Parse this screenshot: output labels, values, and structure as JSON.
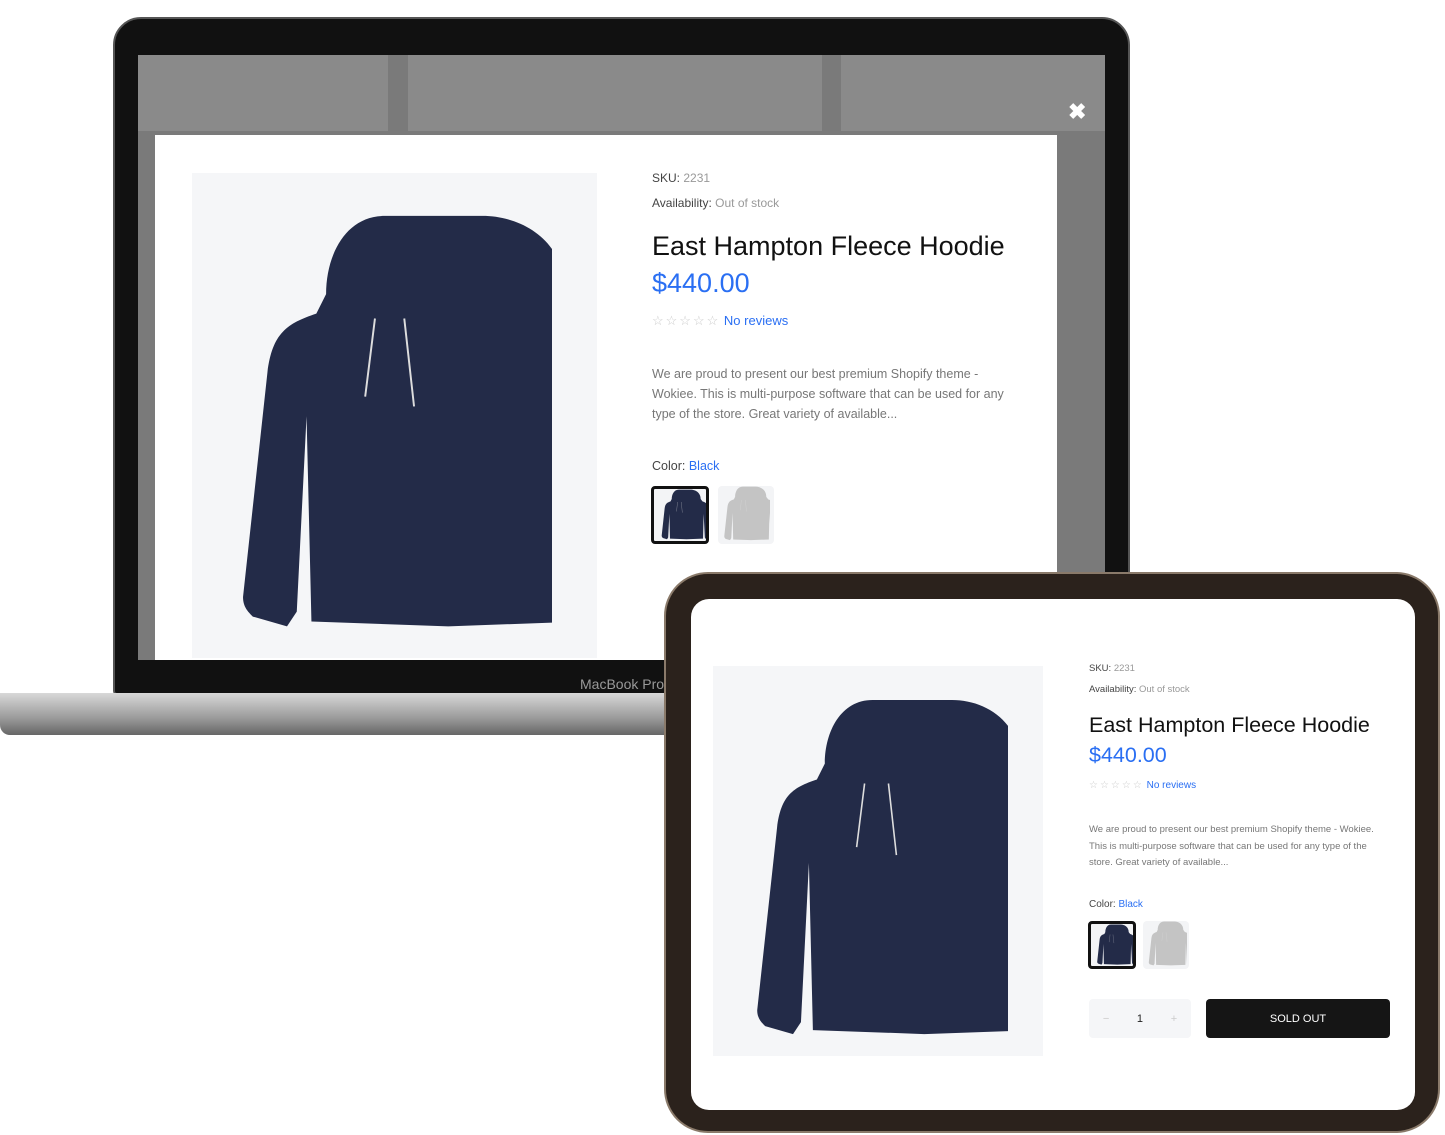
{
  "laptop": {
    "brand": "MacBook Pro",
    "close_icon": "close-icon"
  },
  "product": {
    "sku_label": "SKU:",
    "sku": "2231",
    "availability_label": "Availability:",
    "availability": "Out of stock",
    "title": "East Hampton Fleece Hoodie",
    "price": "$440.00",
    "rating_stars": "☆☆☆☆☆",
    "rating": 0,
    "reviews": "No reviews",
    "description": "We are proud to present our best premium Shopify theme - Wokiee. This is multi-purpose software that can be used for any type of the store. Great variety of available...",
    "color_label": "Color:",
    "color": "Black",
    "swatches": [
      {
        "name": "Black",
        "color": "#222a45",
        "selected": true,
        "unavailable": true
      },
      {
        "name": "Grey",
        "color": "#c4c4c4",
        "selected": false
      }
    ],
    "quantity": "1",
    "minus": "−",
    "plus": "+",
    "sold_out": "SOLD OUT"
  },
  "colors": {
    "accent": "#2a6ff3",
    "hoodie": "#232b48",
    "button": "#151515"
  }
}
